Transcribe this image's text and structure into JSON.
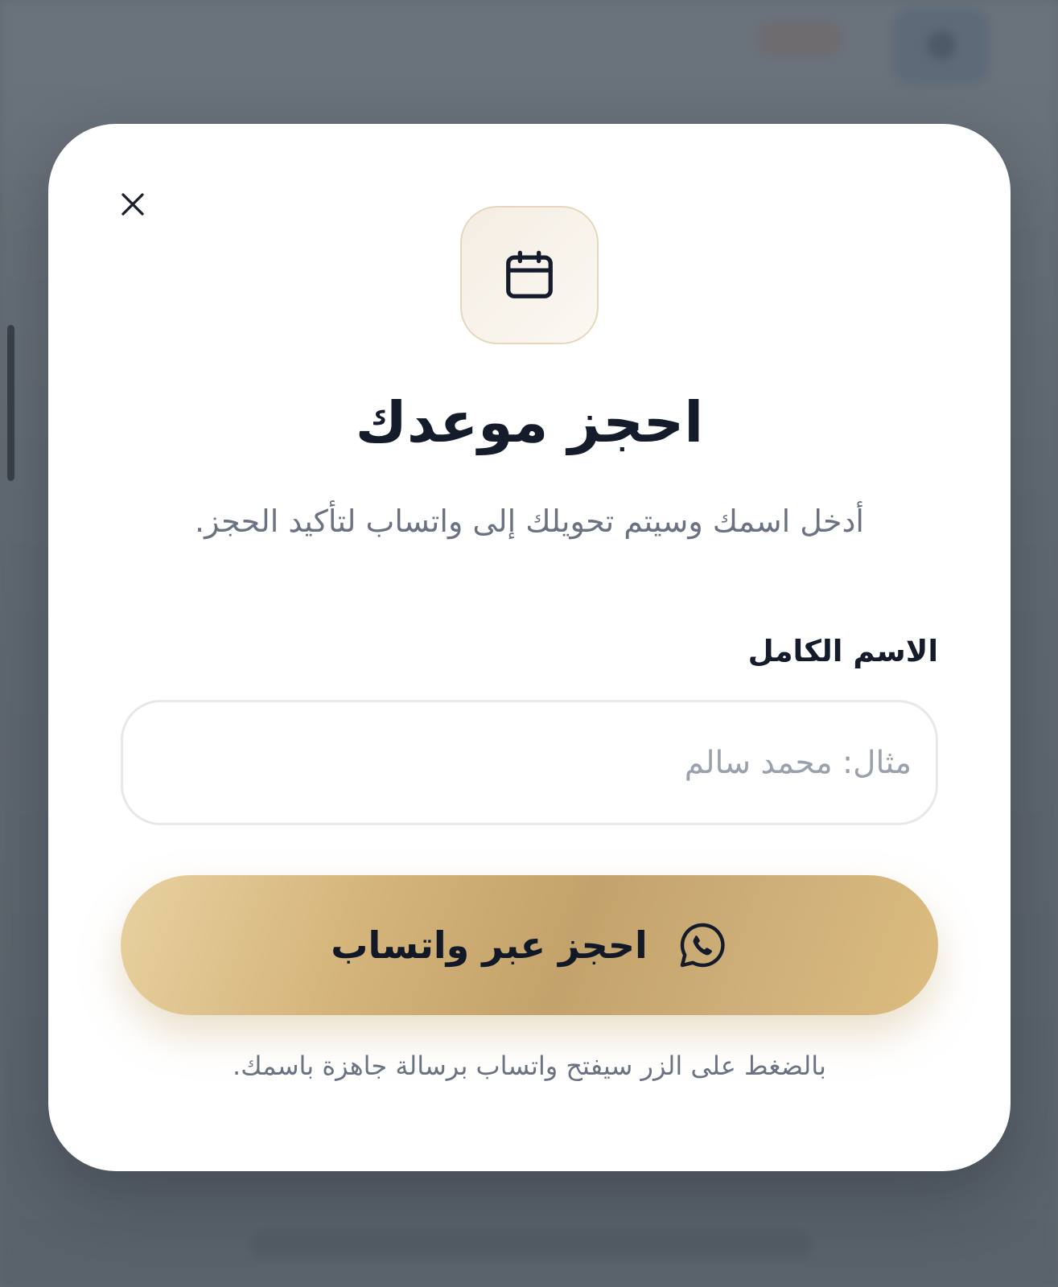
{
  "modal": {
    "close_icon": "close-icon",
    "header_icon": "calendar-icon",
    "title": "احجز موعدك",
    "subtitle": "أدخل اسمك وسيتم تحويلك إلى واتساب لتأكيد الحجز.",
    "name_field": {
      "label": "الاسم الكامل",
      "placeholder": "مثال: محمد سالم",
      "value": ""
    },
    "submit": {
      "label": "احجز عبر واتساب",
      "icon": "whatsapp-icon"
    },
    "note": "بالضغط على الزر سيفتح واتساب برسالة جاهزة باسمك."
  },
  "colors": {
    "accent_gold": "#c4a26b",
    "title_text": "#141b2b",
    "muted_text": "#6b7382",
    "overlay": "#5f6770"
  }
}
